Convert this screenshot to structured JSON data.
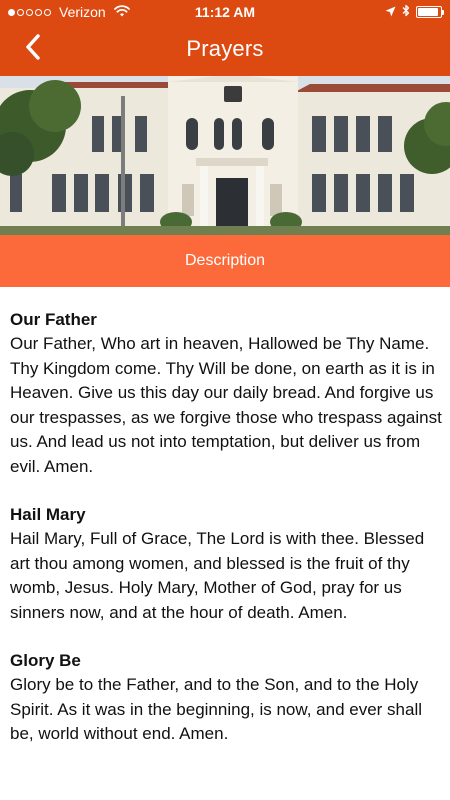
{
  "status_bar": {
    "carrier": "Verizon",
    "time": "11:12 AM",
    "signal_bars_filled": 1,
    "signal_bars_total": 5,
    "battery_level": 0.9
  },
  "nav": {
    "title": "Prayers",
    "back_icon": "chevron-left-icon"
  },
  "hero": {
    "icon": "building-photo"
  },
  "description_tab": {
    "label": "Description"
  },
  "prayers": [
    {
      "title": "Our Father",
      "text": "Our Father, Who art in heaven, Hallowed be Thy Name. Thy Kingdom come. Thy Will be done, on earth as it is in Heaven. Give us this day our daily bread. And forgive us our trespasses, as we forgive those who trespass against us. And lead us not into temptation, but deliver us from evil. Amen."
    },
    {
      "title": "Hail Mary",
      "text": "Hail Mary, Full of Grace, The Lord is with thee. Blessed art thou among women, and blessed is the fruit of thy womb, Jesus. Holy Mary, Mother of God, pray for us sinners now, and at the hour of death. Amen."
    },
    {
      "title": "Glory Be",
      "text": "Glory be to the Father, and to the Son, and to the Holy Spirit. As it was in the beginning, is now, and ever shall be, world without end. Amen."
    }
  ],
  "colors": {
    "header": "#dc4a12",
    "description_bar": "#fc6a3c",
    "text": "#111111"
  }
}
